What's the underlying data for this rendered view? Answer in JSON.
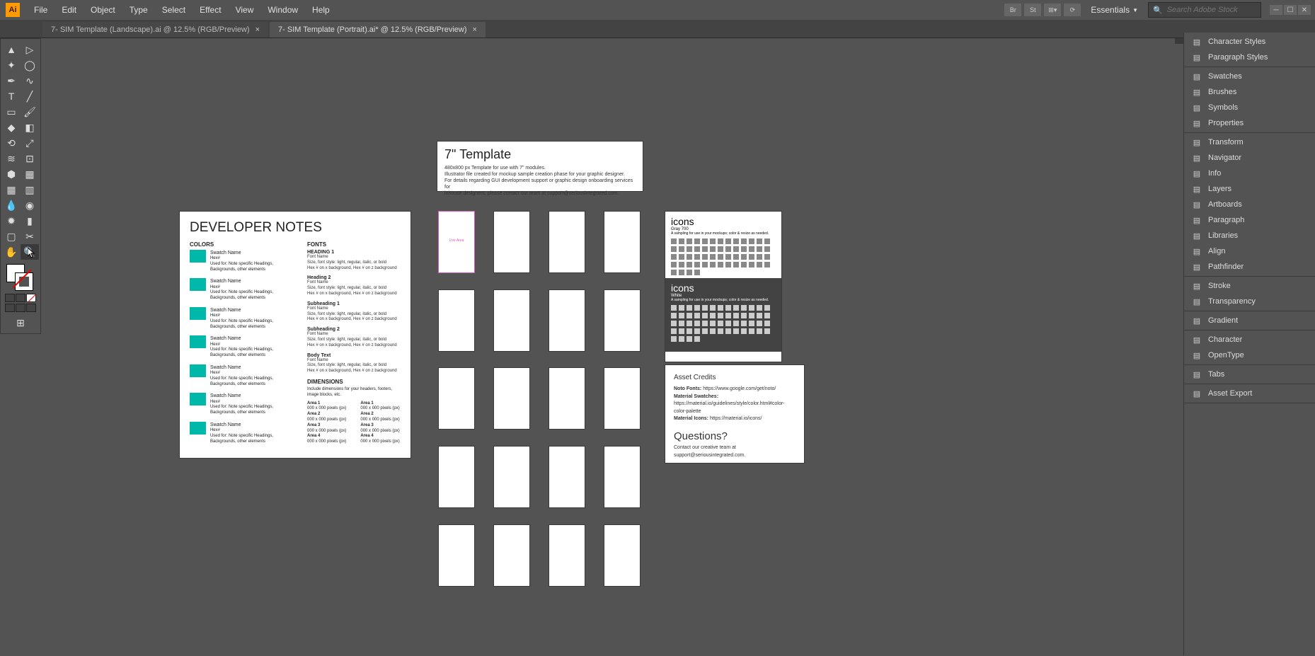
{
  "app": {
    "logo": "Ai"
  },
  "menu": [
    "File",
    "Edit",
    "Object",
    "Type",
    "Select",
    "Effect",
    "View",
    "Window",
    "Help"
  ],
  "topIcons": [
    "Br",
    "St",
    "⊞▾",
    "⟳"
  ],
  "workspace": "Essentials",
  "search": {
    "placeholder": "Search Adobe Stock"
  },
  "tabs": [
    {
      "label": "7- SIM Template (Landscape).ai @ 12.5% (RGB/Preview)",
      "active": false
    },
    {
      "label": "7- SIM Template (Portrait).ai* @ 12.5% (RGB/Preview)",
      "active": true
    }
  ],
  "tools": [
    [
      "selection",
      "direct-selection"
    ],
    [
      "magic-wand",
      "lasso"
    ],
    [
      "pen",
      "curvature"
    ],
    [
      "type",
      "line"
    ],
    [
      "rectangle",
      "paintbrush"
    ],
    [
      "shaper",
      "eraser"
    ],
    [
      "rotate",
      "scale"
    ],
    [
      "width",
      "free-transform"
    ],
    [
      "shape-builder",
      "perspective"
    ],
    [
      "mesh",
      "gradient"
    ],
    [
      "eyedropper",
      "blend"
    ],
    [
      "symbol-sprayer",
      "column-graph"
    ],
    [
      "artboard",
      "slice"
    ],
    [
      "hand",
      "zoom"
    ]
  ],
  "rightPanels": [
    [
      "Character Styles",
      "Paragraph Styles"
    ],
    [
      "Swatches",
      "Brushes",
      "Symbols",
      "Properties"
    ],
    [
      "Transform",
      "Navigator",
      "Info",
      "Layers",
      "Artboards",
      "Paragraph",
      "Libraries",
      "Align",
      "Pathfinder"
    ],
    [
      "Stroke",
      "Transparency"
    ],
    [
      "Gradient"
    ],
    [
      "Character",
      "OpenType"
    ],
    [
      "Tabs"
    ],
    [
      "Asset Export"
    ]
  ],
  "titleCard": {
    "heading": "7\" Template",
    "lines": [
      "480x800 px Template for use with 7\" modules.",
      "Illustrator file created for mockup sample creation phase for your graphic designer.",
      "For details regarding GUI development support or graphic design onboarding services for",
      "inhouse designers, please contact our team at support@seriousintegrated.com."
    ]
  },
  "devNotes": {
    "heading": "DEVELOPER NOTES",
    "colorsTitle": "COLORS",
    "fontsTitle": "FONTS",
    "dimensionsTitle": "DIMENSIONS",
    "dimensionsDesc": "Include dimensions for your headers, footers, image blocks, etc.",
    "swatches": [
      {
        "name": "Swatch Name",
        "hex": "Hex#",
        "used": "Used for: Note specific Headings, Backgrounds, other elements"
      },
      {
        "name": "Swatch Name",
        "hex": "Hex#",
        "used": "Used for: Note specific Headings, Backgrounds, other elements"
      },
      {
        "name": "Swatch Name",
        "hex": "Hex#",
        "used": "Used for: Note specific Headings, Backgrounds, other elements"
      },
      {
        "name": "Swatch Name",
        "hex": "Hex#",
        "used": "Used for: Note specific Headings, Backgrounds, other elements"
      },
      {
        "name": "Swatch Name",
        "hex": "Hex#",
        "used": "Used for: Note specific Headings, Backgrounds, other elements"
      },
      {
        "name": "Swatch Name",
        "hex": "Hex#",
        "used": "Used for: Note specific Headings, Backgrounds, other elements"
      },
      {
        "name": "Swatch Name",
        "hex": "Hex#",
        "used": "Used for: Note specific Headings, Backgrounds, other elements"
      }
    ],
    "fontBlocks": [
      {
        "h": "HEADING 1",
        "lines": [
          "Font Name",
          "Size, font style: light, regular, italic, or bold",
          "Hex # on x background, Hex # on z background"
        ]
      },
      {
        "h": "Heading 2",
        "lines": [
          "Font Name",
          "Size, font style: light, regular, italic, or bold",
          "Hex # on x background, Hex # on z background"
        ]
      },
      {
        "h": "Subheading 1",
        "lines": [
          "Font Name",
          "Size, font style: light, regular, italic, or bold",
          "Hex # on x background, Hex # on z background"
        ]
      },
      {
        "h": "Subheading 2",
        "lines": [
          "Font Name",
          "Size, font style: light, regular, italic, or bold",
          "Hex # on x background, Hex # on z background"
        ]
      },
      {
        "h": "Body Text",
        "lines": [
          "Font Name",
          "Size, font style: light, regular, italic, or bold",
          "Hex # on x background, Hex # on z background"
        ]
      }
    ],
    "areasL": [
      {
        "h": "Area 1",
        "d": "000 x 000 pixels (px)"
      },
      {
        "h": "Area 2",
        "d": "000 x 000 pixels (px)"
      },
      {
        "h": "Area 3",
        "d": "000 x 000 pixels (px)"
      },
      {
        "h": "Area 4",
        "d": "000 x 000 pixels (px)"
      }
    ],
    "areasR": [
      {
        "h": "Area 1",
        "d": "000 x 000 pixels (px)"
      },
      {
        "h": "Area 2",
        "d": "000 x 000 pixels (px)"
      },
      {
        "h": "Area 3",
        "d": "000 x 000 pixels (px)"
      },
      {
        "h": "Area 4",
        "d": "000 x 000 pixels (px)"
      }
    ]
  },
  "templateGrid": {
    "liveArea": "Live Area",
    "cols": [
      562,
      640,
      718,
      796
    ],
    "rows": [
      245,
      356,
      466,
      577,
      688
    ]
  },
  "iconsBoard": {
    "heading": "icons",
    "sub1": "Gray 700",
    "desc": "A sampling for use in your mockups; color & resize as needed.",
    "sub2": "White"
  },
  "credits": {
    "heading": "Asset Credits",
    "items": [
      {
        "b": "Noto Fonts:",
        "t": " https://www.google.com/get/noto/"
      },
      {
        "b": "Material Swatches:",
        "t": ""
      },
      {
        "b": "",
        "t": "https://material.io/guidelines/style/color.html#color-color-palette"
      },
      {
        "b": "Material Icons:",
        "t": " https://material.io/icons/"
      }
    ],
    "qHeading": "Questions?",
    "qText": "Contact our creative team at support@seriousintegrated.com."
  }
}
